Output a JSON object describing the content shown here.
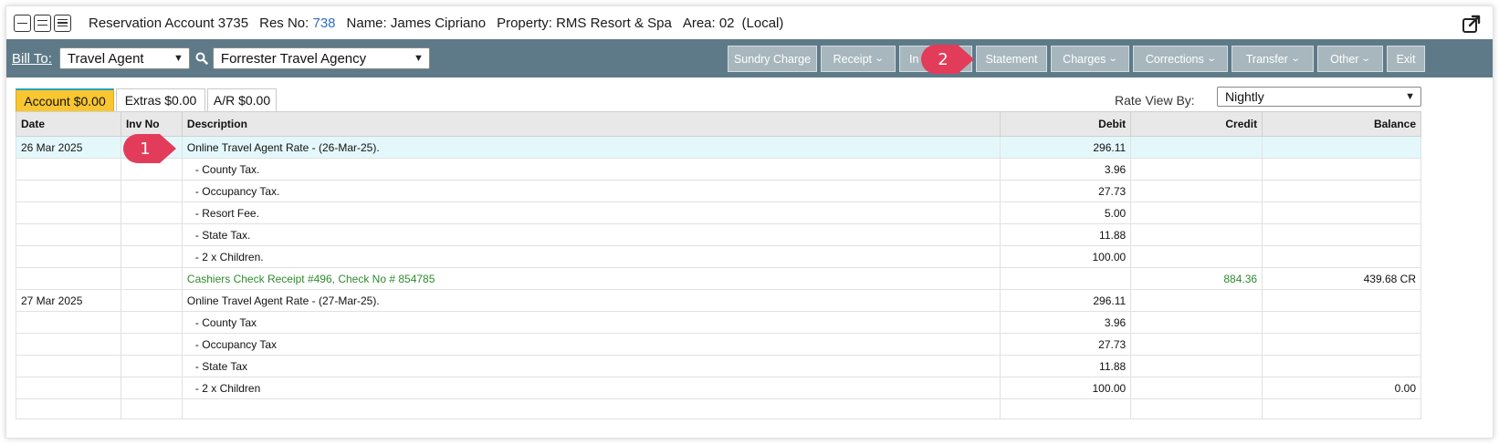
{
  "titlebar": {
    "account": "Reservation Account 3735",
    "resno_label": "Res No:",
    "resno_value": "738",
    "name": "Name: James Cipriano",
    "property": "Property: RMS Resort & Spa",
    "area": "Area: 02",
    "local": "(Local)"
  },
  "toolbar": {
    "billto_label": "Bill To:",
    "billto_type": "Travel Agent",
    "billto_agency": "Forrester Travel Agency",
    "buttons": {
      "sundry": "Sundry Charge",
      "receipt": "Receipt",
      "invoice": "In",
      "statement": "Statement",
      "charges": "Charges",
      "corrections": "Corrections",
      "transfer": "Transfer",
      "other": "Other",
      "exit": "Exit"
    }
  },
  "tabs": {
    "account": "Account $0.00",
    "extras": "Extras $0.00",
    "ar": "A/R $0.00"
  },
  "rateview": {
    "label": "Rate View By:",
    "value": "Nightly"
  },
  "table": {
    "headers": {
      "date": "Date",
      "invno": "Inv No",
      "desc": "Description",
      "debit": "Debit",
      "credit": "Credit",
      "balance": "Balance"
    },
    "rows": [
      {
        "date": "26 Mar 2025",
        "invno": "",
        "desc": "Online Travel Agent Rate - (26-Mar-25).",
        "debit": "296.11",
        "credit": "",
        "balance": ""
      },
      {
        "date": "",
        "invno": "",
        "desc": "- County Tax.",
        "debit": "3.96",
        "credit": "",
        "balance": ""
      },
      {
        "date": "",
        "invno": "",
        "desc": "- Occupancy Tax.",
        "debit": "27.73",
        "credit": "",
        "balance": ""
      },
      {
        "date": "",
        "invno": "",
        "desc": "- Resort Fee.",
        "debit": "5.00",
        "credit": "",
        "balance": ""
      },
      {
        "date": "",
        "invno": "",
        "desc": "- State Tax.",
        "debit": "11.88",
        "credit": "",
        "balance": ""
      },
      {
        "date": "",
        "invno": "",
        "desc": "- 2 x Children.",
        "debit": "100.00",
        "credit": "",
        "balance": ""
      },
      {
        "date": "",
        "invno": "",
        "desc": "Cashiers Check Receipt #496, Check No # 854785",
        "debit": "",
        "credit": "884.36",
        "balance": "439.68 CR"
      },
      {
        "date": "27 Mar 2025",
        "invno": "",
        "desc": "Online Travel Agent Rate - (27-Mar-25).",
        "debit": "296.11",
        "credit": "",
        "balance": ""
      },
      {
        "date": "",
        "invno": "",
        "desc": "- County Tax",
        "debit": "3.96",
        "credit": "",
        "balance": ""
      },
      {
        "date": "",
        "invno": "",
        "desc": "- Occupancy Tax",
        "debit": "27.73",
        "credit": "",
        "balance": ""
      },
      {
        "date": "",
        "invno": "",
        "desc": "- State Tax",
        "debit": "11.88",
        "credit": "",
        "balance": ""
      },
      {
        "date": "",
        "invno": "",
        "desc": "- 2 x Children",
        "debit": "100.00",
        "credit": "",
        "balance": "0.00"
      }
    ]
  },
  "callouts": {
    "one": "1",
    "two": "2"
  },
  "colors": {
    "toolbar_bg": "#5e7a88",
    "button_bg": "#a8b7be",
    "active_tab": "#f8c630",
    "highlight_row": "#e4f8fb",
    "receipt_text": "#2e8a2e",
    "callout": "#e23c5a",
    "resno_link": "#2f6fbf"
  },
  "icons": [
    "minimize-icon",
    "restore-icon",
    "menu-icon",
    "popout-icon",
    "search-icon",
    "chevron-down-icon"
  ]
}
